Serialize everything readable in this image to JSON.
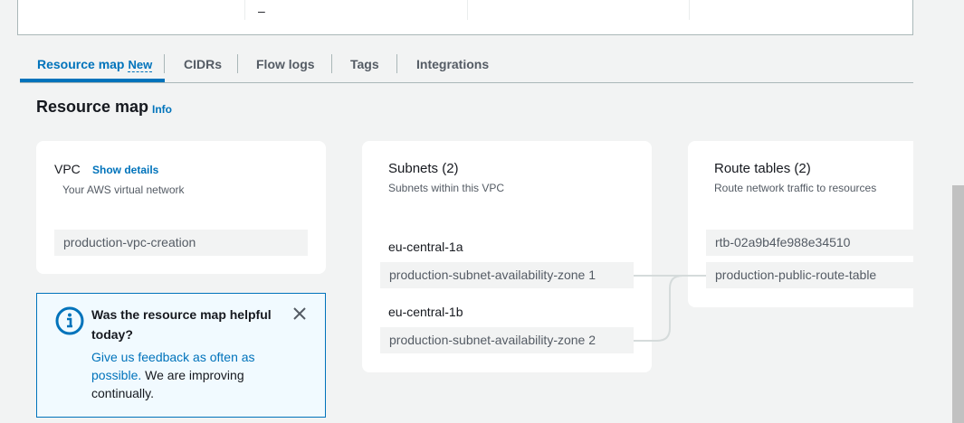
{
  "top_panel": {
    "value": "–"
  },
  "tabs": [
    {
      "label": "Resource map",
      "badge": "New"
    },
    {
      "label": "CIDRs"
    },
    {
      "label": "Flow logs"
    },
    {
      "label": "Tags"
    },
    {
      "label": "Integrations"
    }
  ],
  "section": {
    "title": "Resource map",
    "info": "Info"
  },
  "vpc": {
    "title": "VPC",
    "show_details": "Show details",
    "subtitle": "Your AWS virtual network",
    "name": "production-vpc-creation"
  },
  "subnets": {
    "title": "Subnets (2)",
    "subtitle": "Subnets within this VPC",
    "zones": [
      {
        "az": "eu-central-1a",
        "subnet": "production-subnet-availability-zone 1"
      },
      {
        "az": "eu-central-1b",
        "subnet": "production-subnet-availability-zone 2"
      }
    ]
  },
  "route_tables": {
    "title": "Route tables (2)",
    "subtitle": "Route network traffic to resources",
    "items": [
      "rtb-02a9b4fe988e34510",
      "production-public-route-table"
    ]
  },
  "feedback": {
    "title": "Was the resource map helpful today?",
    "link": "Give us feedback as often as possible.",
    "text": " We are improving continually."
  },
  "colors": {
    "accent": "#0073bb",
    "background": "#f2f3f3",
    "info_bg": "#f1faff"
  }
}
